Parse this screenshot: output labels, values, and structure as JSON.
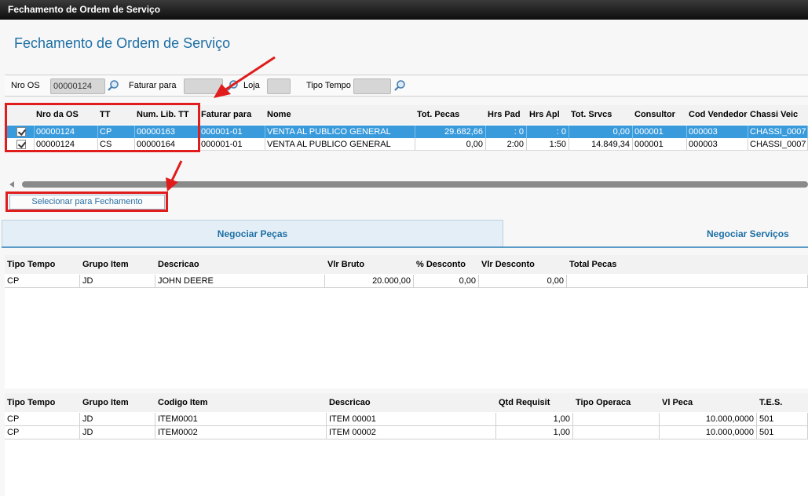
{
  "window": {
    "title": "Fechamento de Ordem de Serviço"
  },
  "page": {
    "title": "Fechamento de Ordem de Serviço"
  },
  "filters": {
    "nro_os_label": "Nro OS",
    "nro_os_value": "00000124",
    "faturar_label": "Faturar para",
    "faturar_value": "",
    "loja_label": "Loja",
    "loja_value": "",
    "tipo_tempo_label": "Tipo Tempo",
    "tipo_tempo_value": ""
  },
  "os_grid": {
    "headers": [
      "Nro da OS",
      "TT",
      "Num. Lib. TT",
      "Faturar para",
      "Nome",
      "Tot. Pecas",
      "Hrs Pad",
      "Hrs Apl",
      "Tot. Srvcs",
      "Consultor",
      "Cod Vendedor",
      "Chassi Veic"
    ],
    "rows": [
      {
        "checked": true,
        "cells": [
          "00000124",
          "CP",
          "00000163",
          "000001-01",
          "VENTA AL PUBLICO GENERAL",
          "29.682,66",
          ": 0",
          ": 0",
          "0,00",
          "000001",
          "000003",
          "CHASSI_0007"
        ]
      },
      {
        "checked": true,
        "cells": [
          "00000124",
          "CS",
          "00000164",
          "000001-01",
          "VENTA AL PUBLICO GENERAL",
          "0,00",
          "2:00",
          "1:50",
          "14.849,34",
          "000001",
          "000003",
          "CHASSI_0007"
        ]
      }
    ]
  },
  "select_button_label": "Selecionar para Fechamento",
  "tabs": {
    "pecas": "Negociar Peças",
    "servicos": "Negociar Serviços"
  },
  "pecas_grid": {
    "headers": [
      "Tipo Tempo",
      "Grupo Item",
      "Descricao",
      "Vlr Bruto",
      "% Desconto",
      "Vlr Desconto",
      "Total Pecas"
    ],
    "rows": [
      [
        "CP",
        "JD",
        "JOHN DEERE",
        "20.000,00",
        "0,00",
        "0,00",
        ""
      ]
    ]
  },
  "itens_grid": {
    "headers": [
      "Tipo Tempo",
      "Grupo Item",
      "Codigo Item",
      "Descricao",
      "Qtd Requisit",
      "Tipo Operaca",
      "Vl Peca",
      "T.E.S."
    ],
    "rows": [
      [
        "CP",
        "JD",
        "ITEM0001",
        "ITEM 00001",
        "1,00",
        "",
        "10.000,0000",
        "501"
      ],
      [
        "CP",
        "JD",
        "ITEM0002",
        "ITEM 00002",
        "1,00",
        "",
        "10.000,0000",
        "501"
      ]
    ]
  },
  "colors": {
    "accent": "#1d6fa5",
    "selection": "#3a9bdc",
    "annotation": "#e01c1c"
  }
}
